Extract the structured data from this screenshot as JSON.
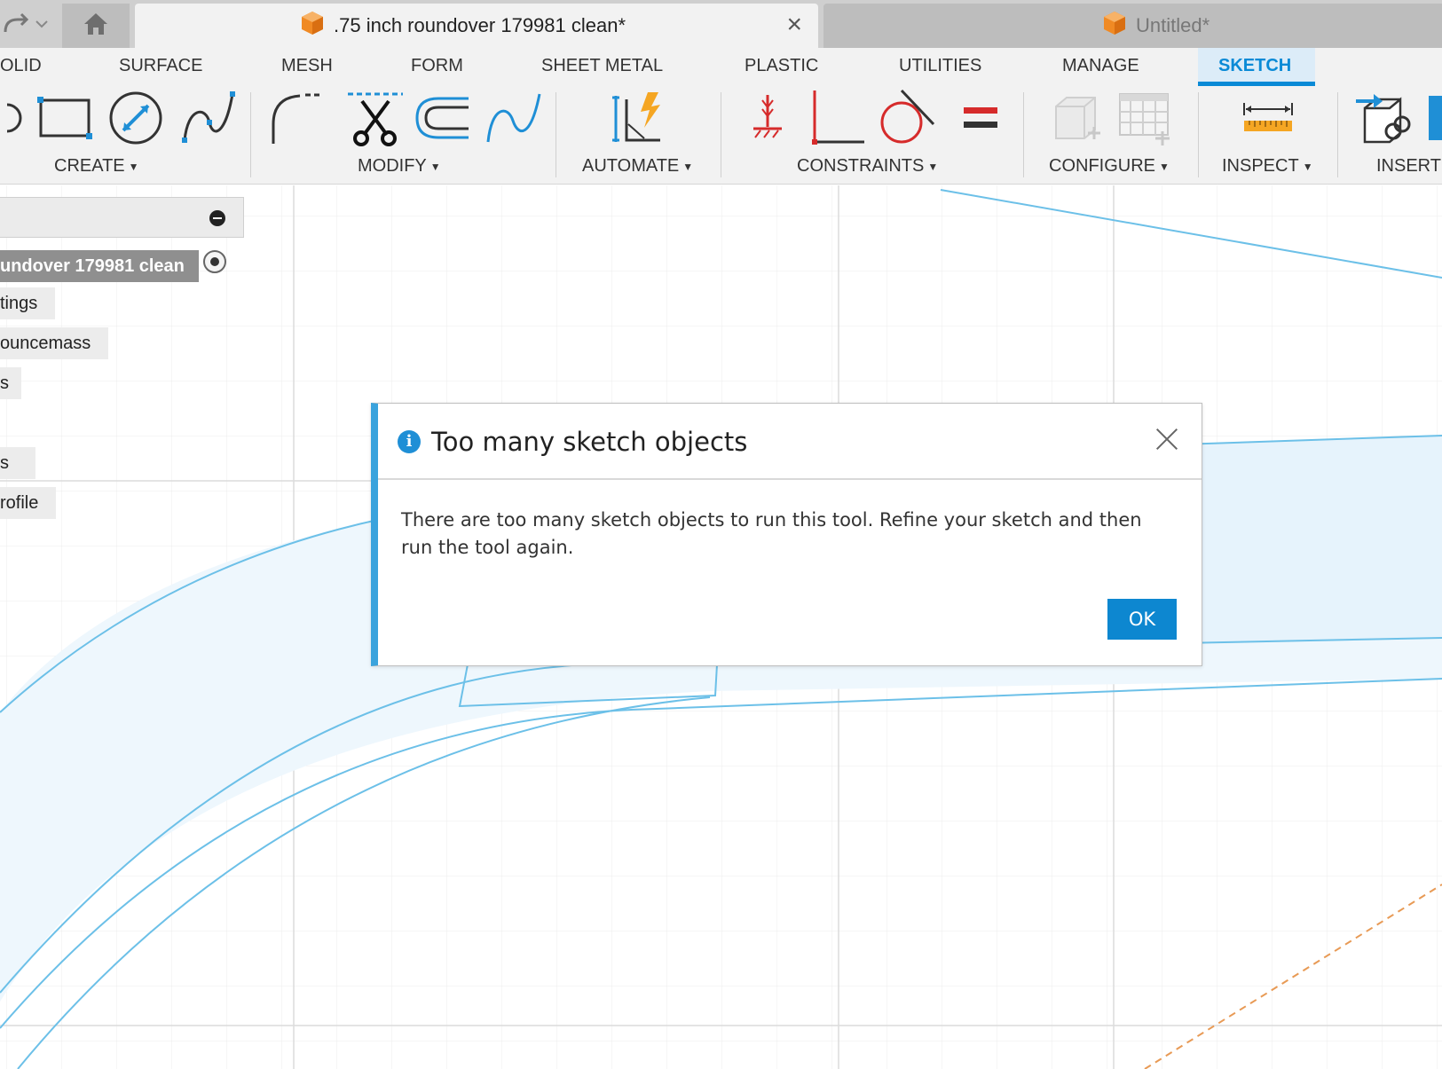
{
  "tabs": {
    "active_title": ".75 inch roundover 179981 clean*",
    "inactive_title": "Untitled*"
  },
  "workspace_tabs": {
    "solid": "OLID",
    "surface": "SURFACE",
    "mesh": "MESH",
    "form": "FORM",
    "sheet_metal": "SHEET METAL",
    "plastic": "PLASTIC",
    "utilities": "UTILITIES",
    "manage": "MANAGE",
    "sketch": "SKETCH"
  },
  "tool_groups": {
    "create": "CREATE",
    "modify": "MODIFY",
    "automate": "AUTOMATE",
    "constraints": "CONSTRAINTS",
    "configure": "CONFIGURE",
    "inspect": "INSPECT",
    "insert": "INSERT"
  },
  "browser": {
    "root": "undover 179981 clean",
    "items": [
      "tings",
      "ouncemass",
      "s",
      "s",
      "rofile"
    ]
  },
  "dialog": {
    "title": "Too many sketch objects",
    "message": "There are too many sketch objects to run this tool. Refine your sketch and then run the tool again.",
    "ok_label": "OK"
  },
  "colors": {
    "accent": "#0a8ad6",
    "sketch_line": "#6cc0e8",
    "profile_fill": "#eef7fd",
    "dialog_bar": "#3aa3dd",
    "ok_button": "#0d87d0",
    "construction_line": "#e89a55"
  },
  "icons": {
    "home": "home-icon",
    "document": "cube-icon",
    "info": "info-icon"
  }
}
